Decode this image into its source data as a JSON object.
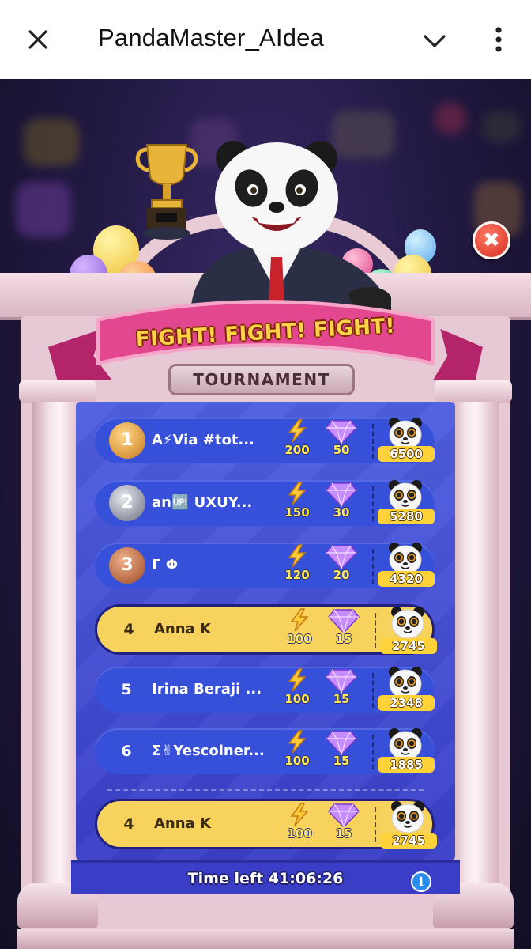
{
  "app_bar": {
    "title": "PandaMaster_AIdea",
    "close_icon": "close-icon",
    "menu_icon": "chevron-down-icon",
    "more_icon": "more-vertical-icon"
  },
  "banner": {
    "headline": "FIGHT! FIGHT! FIGHT!",
    "subtitle": "TOURNAMENT"
  },
  "colors": {
    "board_blue": "#3a44d0",
    "row_blue": "#3750d9",
    "highlight_row": "#f7d25c",
    "ribbon_pink": "#e2478f",
    "score_gold": "#ffd23a"
  },
  "leaderboard": [
    {
      "rank": "1",
      "name": "A⚡Via #tot...",
      "bolts": "200",
      "gems": "50",
      "score": "6500",
      "medal": "gold",
      "highlight": false
    },
    {
      "rank": "2",
      "name": "an🆙 UXUY...",
      "bolts": "150",
      "gems": "30",
      "score": "5280",
      "medal": "silver",
      "highlight": false
    },
    {
      "rank": "3",
      "name": "Γ Φ",
      "bolts": "120",
      "gems": "20",
      "score": "4320",
      "medal": "bronze",
      "highlight": false
    },
    {
      "rank": "4",
      "name": "Anna K",
      "bolts": "100",
      "gems": "15",
      "score": "2745",
      "medal": null,
      "highlight": true
    },
    {
      "rank": "5",
      "name": "Irina Beraji ...",
      "bolts": "100",
      "gems": "15",
      "score": "2348",
      "medal": null,
      "highlight": false
    },
    {
      "rank": "6",
      "name": "Σ✌Yescoiner...",
      "bolts": "100",
      "gems": "15",
      "score": "1885",
      "medal": null,
      "highlight": false
    }
  ],
  "current_player": {
    "rank": "4",
    "name": "Anna K",
    "bolts": "100",
    "gems": "15",
    "score": "2745"
  },
  "footer": {
    "time_left": "Time left 41:06:26",
    "info_icon": "info-icon",
    "info_glyph": "i"
  },
  "close_button_glyph": "✖"
}
